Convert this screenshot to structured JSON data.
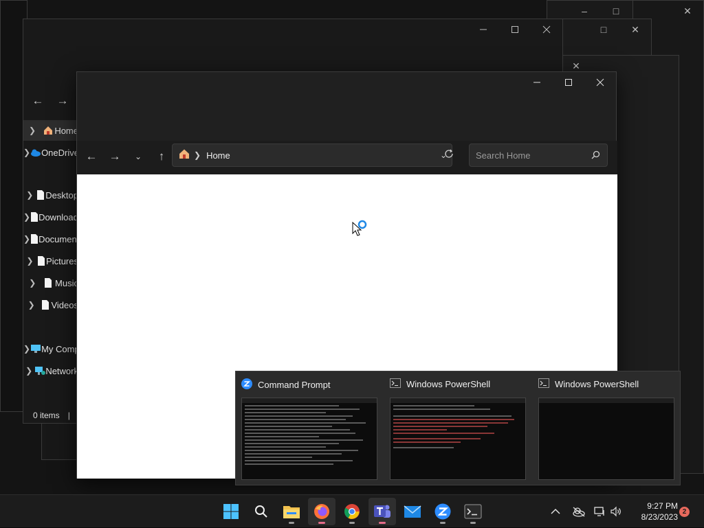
{
  "back_window": {
    "sidebar": [
      {
        "label": "Home",
        "icon": "home-icon"
      },
      {
        "label": "OneDrive",
        "icon": "cloud-icon"
      },
      {
        "label": "Desktop",
        "icon": "document-icon"
      },
      {
        "label": "Downloads",
        "icon": "document-icon"
      },
      {
        "label": "Documents",
        "icon": "document-icon"
      },
      {
        "label": "Pictures",
        "icon": "document-icon"
      },
      {
        "label": "Music",
        "icon": "document-icon"
      },
      {
        "label": "Videos",
        "icon": "document-icon"
      },
      {
        "label": "My Computer",
        "icon": "monitor-icon"
      },
      {
        "label": "Network",
        "icon": "network-icon"
      }
    ],
    "status_items": "0 items",
    "status_sep": "|"
  },
  "front_window": {
    "breadcrumb": "Home",
    "search_placeholder": "Search Home"
  },
  "flyout": {
    "items": [
      {
        "title": "Command Prompt",
        "icon": "zoom-icon"
      },
      {
        "title": "Windows PowerShell",
        "icon": "terminal-icon"
      },
      {
        "title": "Windows PowerShell",
        "icon": "terminal-icon"
      }
    ]
  },
  "taskbar": {
    "apps": [
      "start",
      "search",
      "file-explorer",
      "firefox",
      "chrome",
      "teams",
      "mail",
      "zoom",
      "terminal"
    ],
    "time": "9:27 PM",
    "date": "8/23/2023",
    "notification_count": "2"
  },
  "colors": {
    "accent": "#0078d4",
    "badge": "#e7695c",
    "folder": "#f2c14e"
  }
}
